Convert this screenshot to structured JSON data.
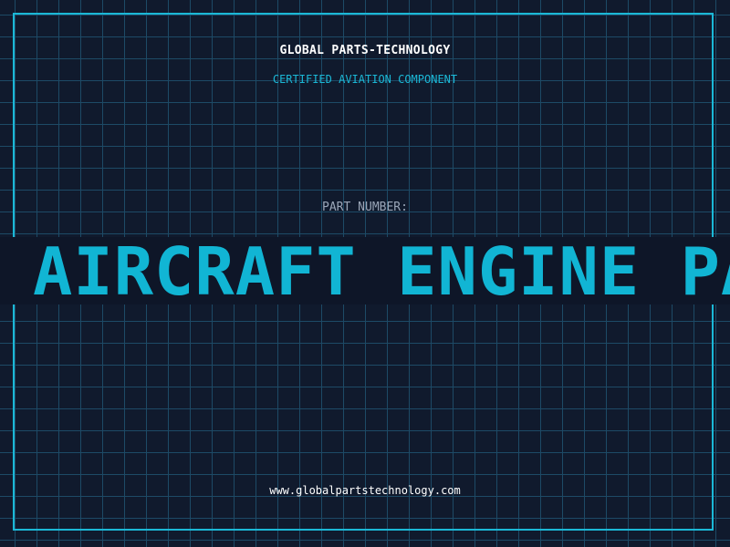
{
  "header": {
    "company": "GLOBAL PARTS-TECHNOLOGY",
    "subtitle": "CERTIFIED AVIATION COMPONENT"
  },
  "part": {
    "label": "PART NUMBER:",
    "banner_text": "AIRCRAFT ENGINE PARTS"
  },
  "footer": {
    "website": "www.globalpartstechnology.com"
  },
  "colors": {
    "background": "#101a2d",
    "grid": "#1d4a66",
    "accent": "#1bb8d6",
    "text": "#ffffff",
    "muted": "#9aa6b8"
  }
}
